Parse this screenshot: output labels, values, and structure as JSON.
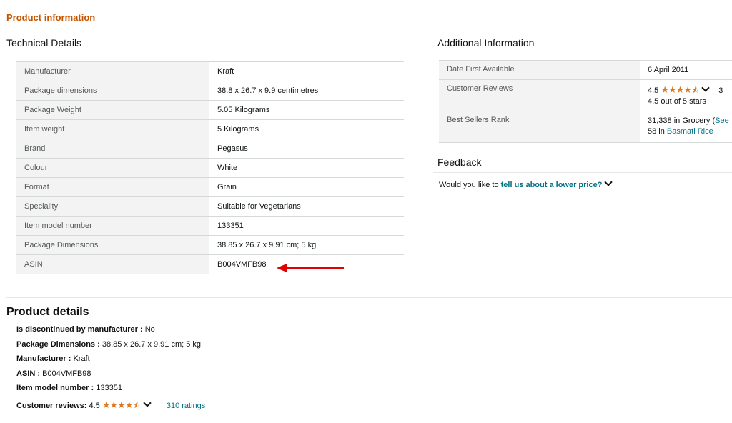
{
  "section_title": "Product information",
  "technical": {
    "title": "Technical Details",
    "rows": [
      {
        "key": "Manufacturer",
        "value": "Kraft"
      },
      {
        "key": "Package dimensions",
        "value": "38.8 x 26.7 x 9.9 centimetres"
      },
      {
        "key": "Package Weight",
        "value": "5.05 Kilograms"
      },
      {
        "key": "Item weight",
        "value": "5 Kilograms"
      },
      {
        "key": "Brand",
        "value": "Pegasus"
      },
      {
        "key": "Colour",
        "value": "White"
      },
      {
        "key": "Format",
        "value": "Grain"
      },
      {
        "key": "Speciality",
        "value": "Suitable for Vegetarians"
      },
      {
        "key": "Item model number",
        "value": "133351"
      },
      {
        "key": "Package Dimensions",
        "value": "38.85 x 26.7 x 9.91 cm; 5 kg"
      },
      {
        "key": "ASIN",
        "value": "B004VMFB98"
      }
    ]
  },
  "additional": {
    "title": "Additional Information",
    "date_key": "Date First Available",
    "date_value": "6 April 2011",
    "reviews_key": "Customer Reviews",
    "reviews_rating": "4.5",
    "reviews_stars": "★★★★⯪",
    "reviews_text": "4.5 out of 5 stars",
    "reviews_cut": "3",
    "rank_key": "Best Sellers Rank",
    "rank_line1": "31,338 in Grocery (",
    "rank_line1_link": "See",
    "rank_line2_num": "58 in ",
    "rank_line2_link": "Basmati Rice"
  },
  "feedback": {
    "title": "Feedback",
    "prefix": "Would you like to ",
    "link": "tell us about a lower price?"
  },
  "product_details": {
    "title": "Product details",
    "items": [
      {
        "label": "Is discontinued by manufacturer",
        "sep": " : ",
        "value": "No"
      },
      {
        "label": "Package Dimensions",
        "sep": " : ",
        "value": "38.85 x 26.7 x 9.91 cm; 5 kg"
      },
      {
        "label": "Manufacturer",
        "sep": " : ",
        "value": "Kraft"
      },
      {
        "label": "ASIN",
        "sep": " : ",
        "value": "B004VMFB98"
      },
      {
        "label": "Item model number",
        "sep": " : ",
        "value": "133351"
      }
    ],
    "reviews_label": "Customer reviews:",
    "reviews_rating": "4.5",
    "reviews_stars": "★★★★⯪",
    "ratings_link": "310 ratings"
  },
  "colors": {
    "accent": "#c45500",
    "link": "#007185",
    "star": "#de7921",
    "annotation_arrow": "#e00000"
  }
}
